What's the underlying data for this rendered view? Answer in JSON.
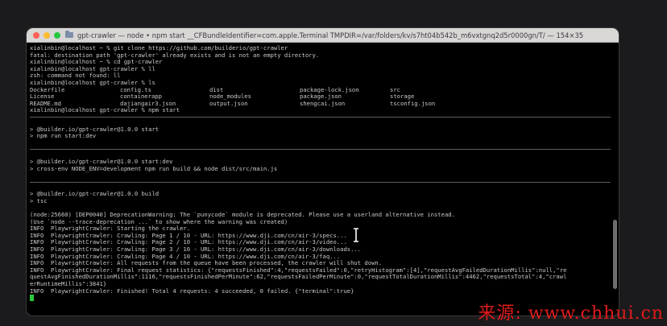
{
  "window": {
    "title": "gpt-crawler — node • npm start __CFBundleIdentifier=com.apple.Terminal TMPDIR=/var/folders/kv/s7ht04b542b_m6vxtgnq2d5r0000gn/T/ — 154×35"
  },
  "terminal": {
    "head_lines": [
      "xialinbin@localhost ~ % git clone https://github.com/builderio/gpt-crawler",
      "fatal: destination path 'gpt-crawler' already exists and is not an empty directory.",
      "xialinbin@localhost ~ % cd gpt-crawler",
      "xialinbin@localhost gpt-crawler % ll",
      "zsh: command not found: ll",
      "xialinbin@localhost gpt-crawler % ls"
    ],
    "ls_rows": [
      [
        "Dockerfile",
        "config.ts",
        "dist",
        "package-lock.json",
        "src"
      ],
      [
        "License",
        "containerapp",
        "node_modules",
        "package.json",
        "storage"
      ],
      [
        "README.md",
        "dajiangair3.json",
        "output.json",
        "shengcai.json",
        "tsconfig.json"
      ]
    ],
    "prompt_npm": "xialinbin@localhost gpt-crawler % npm start",
    "block1": [
      "> @builder.io/gpt-crawler@1.0.0 start",
      "> npm run start:dev"
    ],
    "block2": [
      "> @builder.io/gpt-crawler@1.0.0 start:dev",
      "> cross-env NODE_ENV=development npm run build && node dist/src/main.js"
    ],
    "block3": [
      "> @builder.io/gpt-crawler@1.0.0 build",
      "> tsc"
    ],
    "log_lines": [
      "(node:25660) [DEP0040] DeprecationWarning: The `punycode` module is deprecated. Please use a userland alternative instead.",
      "(Use `node --trace-deprecation ...` to show where the warning was created)",
      "INFO  PlaywrightCrawler: Starting the crawler.",
      "INFO  PlaywrightCrawler: Crawling: Page 1 / 10 - URL: https://www.dji.com/cn/air-3/specs...",
      "INFO  PlaywrightCrawler: Crawling: Page 2 / 10 - URL: https://www.dji.com/cn/air-3/video...",
      "INFO  PlaywrightCrawler: Crawling: Page 3 / 10 - URL: https://www.dji.com/cn/air-3/downloads...",
      "INFO  PlaywrightCrawler: Crawling: Page 4 / 10 - URL: https://www.dji.com/cn/air-3/faq...",
      "INFO  PlaywrightCrawler: All requests from the queue have been processed, the crawler will shut down.",
      "INFO  PlaywrightCrawler: Final request statistics: {\"requestsFinished\":4,\"requestsFailed\":0,\"retryHistogram\":[4],\"requestAvgFailedDurationMillis\":null,\"re",
      "questAvgFinishedDurationMillis\":1116,\"requestsFinishedPerMinute\":62,\"requestsFailedPerMinute\":0,\"requestTotalDurationMillis\":4462,\"requestsTotal\":4,\"crawl",
      "erRuntimeMillis\":3841}",
      "INFO  PlaywrightCrawler: Finished! Total 4 requests: 4 succeeded, 0 failed. {\"terminal\":true}"
    ]
  },
  "watermark": "来源: www.chhui.cn"
}
